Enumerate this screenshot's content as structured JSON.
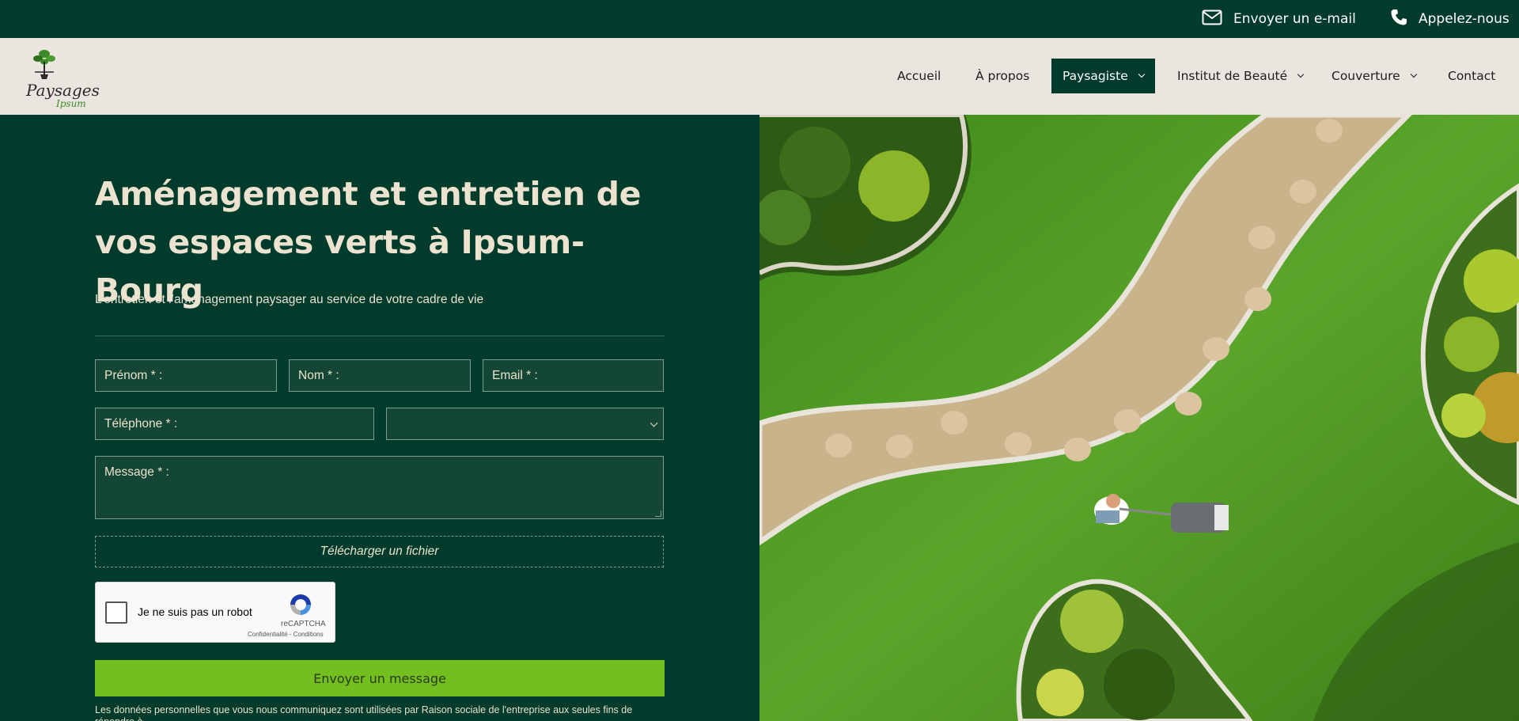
{
  "topbar": {
    "email_label": "Envoyer un e-mail",
    "phone_label": "Appelez-nous"
  },
  "logo": {
    "brand": "Paysages",
    "brand2": "Ipsum"
  },
  "nav": {
    "items": [
      {
        "label": "Accueil"
      },
      {
        "label": "À propos"
      },
      {
        "label": "Paysagiste"
      },
      {
        "label": "Institut de Beauté"
      },
      {
        "label": "Couverture"
      },
      {
        "label": "Contact"
      }
    ],
    "active": "Paysagiste"
  },
  "hero": {
    "title": "Aménagement et entretien de vos espaces verts à Ipsum-Bourg",
    "subtitle": "L’entretien et l’aménagement paysager au service de votre cadre de vie"
  },
  "form": {
    "firstname_placeholder": "Prénom * :",
    "lastname_placeholder": "Nom  *  :",
    "email_placeholder": "Email * :",
    "phone_placeholder": "Téléphone * :",
    "select_value": "",
    "message_placeholder": "Message * :",
    "upload_label": "Télécharger un fichier",
    "submit_label": "Envoyer un message",
    "legal_text": "Les données personnelles que vous nous communiquez sont utilisées par Raison sociale de l'entreprise aux seules fins de répondre à"
  },
  "recaptcha": {
    "label": "Je ne suis pas un robot",
    "brand": "reCAPTCHA",
    "terms": "Confidentialité - Conditions"
  },
  "colors": {
    "dark_green": "#003b2b",
    "header_bg": "#ebe5df",
    "accent_green": "#72bf1f",
    "cream_text": "#ebe2cf"
  }
}
